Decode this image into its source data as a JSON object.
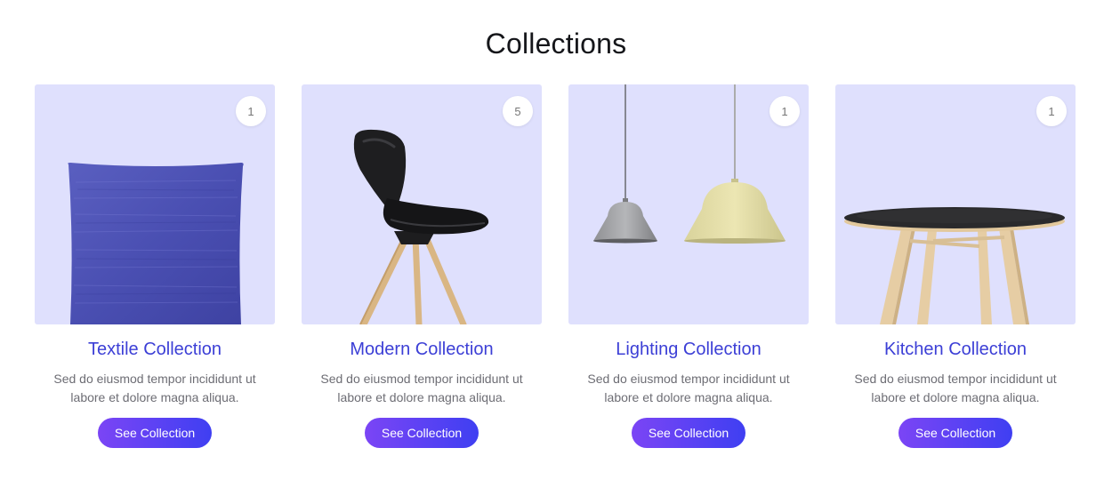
{
  "section": {
    "title": "Collections"
  },
  "colors": {
    "title": "#15161a",
    "card_title": "#3c3fd6",
    "image_bg": "#dfe0fd",
    "button_gradient_start": "#7b45f5",
    "button_gradient_end": "#3f3ff2"
  },
  "collections": [
    {
      "title": "Textile Collection",
      "count": "1",
      "description": "Sed do eiusmod tempor incididunt ut labore et dolore magna aliqua.",
      "button_label": "See Collection",
      "image": "pillow-image"
    },
    {
      "title": "Modern Collection",
      "count": "5",
      "description": "Sed do eiusmod tempor incididunt ut labore et dolore magna aliqua.",
      "button_label": "See Collection",
      "image": "chair-image"
    },
    {
      "title": "Lighting Collection",
      "count": "1",
      "description": "Sed do eiusmod tempor incididunt ut labore et dolore magna aliqua.",
      "button_label": "See Collection",
      "image": "pendant-lamps-image"
    },
    {
      "title": "Kitchen Collection",
      "count": "1",
      "description": "Sed do eiusmod tempor incididunt ut labore et dolore magna aliqua.",
      "button_label": "See Collection",
      "image": "table-image"
    }
  ]
}
